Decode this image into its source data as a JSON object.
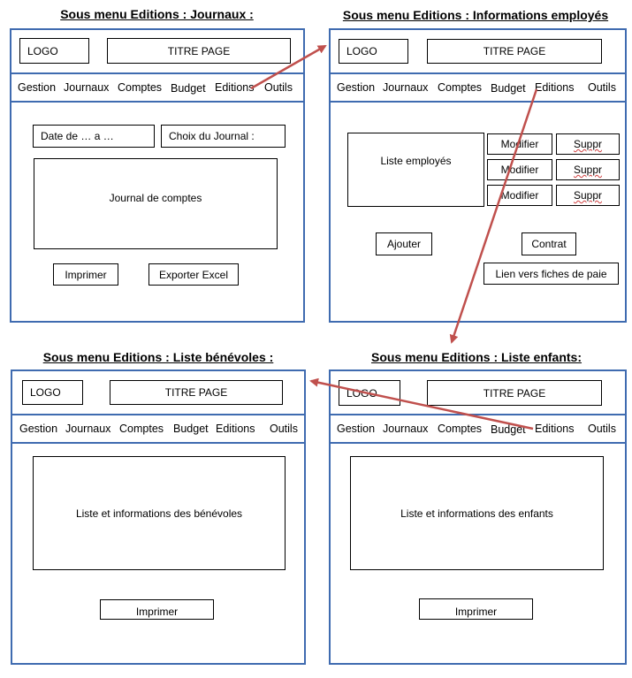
{
  "headings": {
    "journaux": "Sous menu Editions  : Journaux :",
    "employes": "Sous menu Editions  : Informations employés",
    "benevoles": "Sous menu Editions  : Liste bénévoles :",
    "enfants": "Sous menu Editions  : Liste enfants:"
  },
  "header": {
    "logo": "LOGO",
    "title": "TITRE PAGE"
  },
  "nav": [
    "Gestion",
    "Journaux",
    "Comptes",
    "Budget",
    "Editions",
    "Outils"
  ],
  "journaux": {
    "date_field": "Date de … a …",
    "journal_select": "Choix du Journal :",
    "journal_box": "Journal de comptes",
    "print_button": "Imprimer",
    "export_button": "Exporter Excel"
  },
  "employes": {
    "list_box": "Liste employés",
    "modify_label": "Modifier",
    "delete_label": "Suppr",
    "add_button": "Ajouter",
    "contract_button": "Contrat",
    "payslip_link": "Lien vers fiches de paie"
  },
  "benevoles": {
    "list_box": "Liste et informations des bénévoles",
    "print_button": "Imprimer"
  },
  "enfants": {
    "list_box": "Liste et informations des enfants",
    "print_button": "Imprimer"
  },
  "colors": {
    "frame_border": "#3f6bb0",
    "arrow": "#c0504d"
  }
}
